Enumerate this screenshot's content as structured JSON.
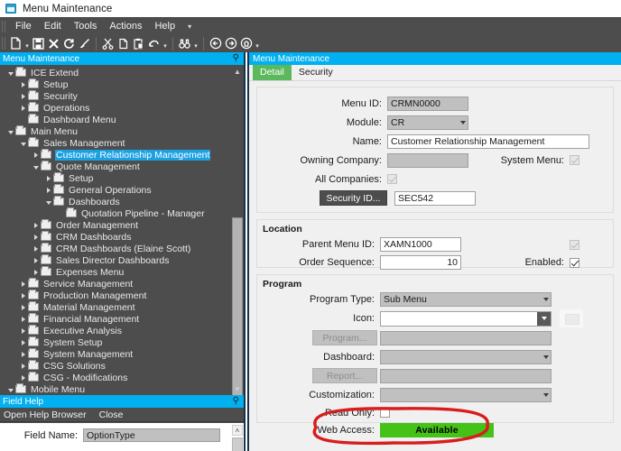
{
  "window": {
    "title": "Menu Maintenance",
    "icon": "window-icon"
  },
  "menubar": {
    "items": [
      "File",
      "Edit",
      "Tools",
      "Actions",
      "Help"
    ],
    "overflow_caret": "▾"
  },
  "toolbar": {
    "buttons": [
      {
        "name": "new-icon",
        "glyph": "new"
      },
      {
        "name": "new-dropdown-caret",
        "glyph": "caret"
      },
      {
        "name": "save-icon",
        "glyph": "save"
      },
      {
        "name": "delete-icon",
        "glyph": "x"
      },
      {
        "name": "refresh-icon",
        "glyph": "refresh"
      },
      {
        "name": "clear-icon",
        "glyph": "brush"
      },
      {
        "name": "cut-icon",
        "glyph": "scissors"
      },
      {
        "name": "copy-icon",
        "glyph": "copy"
      },
      {
        "name": "paste-icon",
        "glyph": "paste"
      },
      {
        "name": "undo-icon",
        "glyph": "undo"
      },
      {
        "name": "undo-dropdown-caret",
        "glyph": "caret"
      },
      {
        "name": "search-icon",
        "glyph": "binoculars"
      },
      {
        "name": "search-dropdown-caret",
        "glyph": "caret"
      },
      {
        "name": "back-icon",
        "glyph": "back"
      },
      {
        "name": "forward-icon",
        "glyph": "forward"
      },
      {
        "name": "home-icon",
        "glyph": "home"
      },
      {
        "name": "nav-dropdown-caret",
        "glyph": "caret"
      }
    ]
  },
  "left_pane": {
    "header": "Menu Maintenance",
    "pin_icon": "pin-icon",
    "tree": [
      {
        "label": "ICE Extend",
        "indent": 0,
        "state": "expanded",
        "selected": false
      },
      {
        "label": "Setup",
        "indent": 1,
        "state": "collapsed",
        "selected": false
      },
      {
        "label": "Security",
        "indent": 1,
        "state": "collapsed",
        "selected": false
      },
      {
        "label": "Operations",
        "indent": 1,
        "state": "collapsed",
        "selected": false
      },
      {
        "label": "Dashboard Menu",
        "indent": 1,
        "state": "leaf",
        "selected": false
      },
      {
        "label": "Main Menu",
        "indent": 0,
        "state": "expanded",
        "selected": false
      },
      {
        "label": "Sales Management",
        "indent": 1,
        "state": "expanded",
        "selected": false
      },
      {
        "label": "Customer Relationship Management",
        "indent": 2,
        "state": "collapsed",
        "selected": true
      },
      {
        "label": "Quote Management",
        "indent": 2,
        "state": "expanded",
        "selected": false
      },
      {
        "label": "Setup",
        "indent": 3,
        "state": "collapsed",
        "selected": false
      },
      {
        "label": "General Operations",
        "indent": 3,
        "state": "collapsed",
        "selected": false
      },
      {
        "label": "Dashboards",
        "indent": 3,
        "state": "expanded",
        "selected": false
      },
      {
        "label": "Quotation Pipeline - Manager",
        "indent": 4,
        "state": "leaf",
        "selected": false
      },
      {
        "label": "Order Management",
        "indent": 2,
        "state": "collapsed",
        "selected": false
      },
      {
        "label": "CRM Dashboards",
        "indent": 2,
        "state": "collapsed",
        "selected": false
      },
      {
        "label": "CRM Dashboards (Elaine Scott)",
        "indent": 2,
        "state": "collapsed",
        "selected": false
      },
      {
        "label": "Sales Director Dashboards",
        "indent": 2,
        "state": "collapsed",
        "selected": false
      },
      {
        "label": "Expenses Menu",
        "indent": 2,
        "state": "collapsed",
        "selected": false
      },
      {
        "label": "Service Management",
        "indent": 1,
        "state": "collapsed",
        "selected": false
      },
      {
        "label": "Production Management",
        "indent": 1,
        "state": "collapsed",
        "selected": false
      },
      {
        "label": "Material Management",
        "indent": 1,
        "state": "collapsed",
        "selected": false
      },
      {
        "label": "Financial Management",
        "indent": 1,
        "state": "collapsed",
        "selected": false
      },
      {
        "label": "Executive Analysis",
        "indent": 1,
        "state": "collapsed",
        "selected": false
      },
      {
        "label": "System Setup",
        "indent": 1,
        "state": "collapsed",
        "selected": false
      },
      {
        "label": "System Management",
        "indent": 1,
        "state": "collapsed",
        "selected": false
      },
      {
        "label": "CSG Solutions",
        "indent": 1,
        "state": "collapsed",
        "selected": false
      },
      {
        "label": "CSG - Modifications",
        "indent": 1,
        "state": "collapsed",
        "selected": false
      },
      {
        "label": "Mobile Menu",
        "indent": 0,
        "state": "expanded",
        "selected": false
      }
    ]
  },
  "field_help": {
    "header": "Field Help",
    "pin_icon": "pin-icon",
    "actions": [
      "Open Help Browser",
      "Close"
    ],
    "field_name_label": "Field Name:",
    "field_name_value": "OptionType"
  },
  "right_pane": {
    "header": "Menu Maintenance",
    "tabs": [
      {
        "label": "Detail",
        "active": true
      },
      {
        "label": "Security",
        "active": false
      }
    ],
    "detail": {
      "menu_id_label": "Menu ID:",
      "menu_id_value": "CRMN0000",
      "module_label": "Module:",
      "module_value": "CR",
      "name_label": "Name:",
      "name_value": "Customer Relationship Management",
      "owning_company_label": "Owning Company:",
      "owning_company_value": "",
      "system_menu_label": "System Menu:",
      "system_menu_checked": true,
      "all_companies_label": "All Companies:",
      "all_companies_checked": true,
      "security_id_button": "Security ID...",
      "security_id_value": "SEC542"
    },
    "location": {
      "title": "Location",
      "parent_menu_id_label": "Parent Menu ID:",
      "parent_menu_id_value": "XAMN1000",
      "order_sequence_label": "Order Sequence:",
      "order_sequence_value": "10",
      "top_right_checked": true,
      "enabled_label": "Enabled:",
      "enabled_checked": true
    },
    "program": {
      "title": "Program",
      "program_type_label": "Program Type:",
      "program_type_value": "Sub Menu",
      "icon_label": "Icon:",
      "icon_value": "",
      "program_button": "Program...",
      "program_value": "",
      "dashboard_label": "Dashboard:",
      "dashboard_value": "",
      "report_button": "Report...",
      "report_value": "",
      "customization_label": "Customization:",
      "customization_value": "",
      "read_only_label": "Read Only:",
      "read_only_checked": false,
      "web_access_label": "Web Access:",
      "web_access_value": "Available"
    }
  },
  "annotation": {
    "shape": "red-oval-highlight",
    "color": "#d81d1d"
  },
  "colors": {
    "accent_blue": "#00b0f0",
    "selection_blue": "#1ba1e2",
    "tab_green": "#5cb85c",
    "badge_green": "#44c217",
    "chrome_dark": "#4d4d4d",
    "annotation_red": "#d81d1d"
  }
}
